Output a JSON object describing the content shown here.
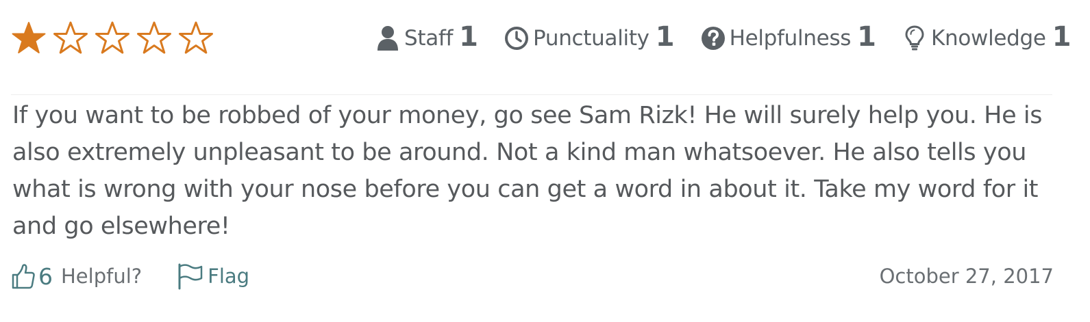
{
  "rating": {
    "overall": 1,
    "max": 5,
    "filled_color": "#d97a1f",
    "empty_color": "#d97a1f"
  },
  "categories": [
    {
      "label": "Staff",
      "value": "1",
      "icon": "user-icon"
    },
    {
      "label": "Punctuality",
      "value": "1",
      "icon": "clock-icon"
    },
    {
      "label": "Helpfulness",
      "value": "1",
      "icon": "question-circle-icon"
    },
    {
      "label": "Knowledge",
      "value": "1",
      "icon": "lightbulb-icon"
    }
  ],
  "review": {
    "text": "If you want to be robbed of your money, go see Sam Rizk! He will surely help you. He is also extremely unpleasant to be around. Not a kind man whatsoever. He also tells you what is wrong with your nose before you can get a word in about it. Take my word for it and go elsewhere!"
  },
  "footer": {
    "helpful_count": "6",
    "helpful_label": "Helpful?",
    "flag_label": "Flag",
    "date": "October 27, 2017"
  },
  "colors": {
    "accent_teal": "#4a7b80",
    "icon_gray": "#5b6166",
    "star_orange": "#d97a1f"
  }
}
